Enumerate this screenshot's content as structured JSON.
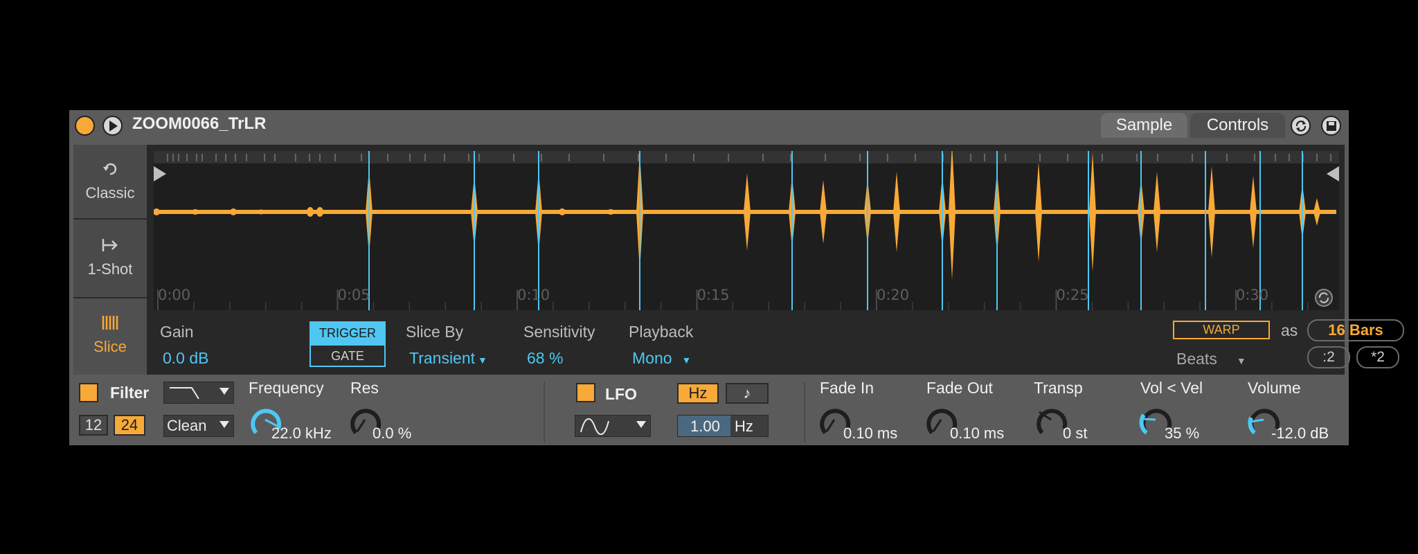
{
  "header": {
    "title": "ZOOM0066_TrLR",
    "tabs": [
      {
        "label": "Sample",
        "active": true
      },
      {
        "label": "Controls",
        "active": false
      }
    ],
    "icons": [
      "power-icon",
      "play-icon",
      "refresh-icon",
      "save-icon"
    ]
  },
  "modes": {
    "classic": "Classic",
    "oneshot": "1-Shot",
    "slice": "Slice",
    "active": "Slice"
  },
  "waveform": {
    "time_labels": [
      "0:00",
      "0:05",
      "0:10",
      "0:15",
      "0:20",
      "0:25",
      "0:30"
    ],
    "slice_marker_count": 13,
    "colors": {
      "wave": "#f8a937",
      "slice": "#4fc7f2",
      "background": "#1e1e1e"
    }
  },
  "sample_params": {
    "gain_label": "Gain",
    "gain_value": "0.0 dB",
    "trigger": "TRIGGER",
    "gate": "GATE",
    "slice_by_label": "Slice By",
    "slice_by_value": "Transient",
    "sensitivity_label": "Sensitivity",
    "sensitivity_value": "68 %",
    "playback_label": "Playback",
    "playback_value": "Mono",
    "warp": "WARP",
    "as": "as",
    "bars": "16 Bars",
    "warp_mode": "Beats",
    "half": ":2",
    "double": "*2"
  },
  "filter": {
    "label": "Filter",
    "slope_12": "12",
    "slope_24": "24",
    "circuit": "Clean",
    "frequency_label": "Frequency",
    "frequency_value": "22.0 kHz",
    "res_label": "Res",
    "res_value": "0.0 %"
  },
  "lfo": {
    "label": "LFO",
    "hz_btn": "Hz",
    "note_btn": "♪",
    "rate": "1.00",
    "rate_unit": "Hz"
  },
  "envelope": {
    "fade_in_label": "Fade In",
    "fade_in_value": "0.10 ms",
    "fade_out_label": "Fade Out",
    "fade_out_value": "0.10 ms",
    "transp_label": "Transp",
    "transp_value": "0 st",
    "vel_label": "Vol < Vel",
    "vel_value": "35 %",
    "volume_label": "Volume",
    "volume_value": "-12.0 dB"
  },
  "accent": "#f8a937",
  "blue": "#4fc7f2"
}
